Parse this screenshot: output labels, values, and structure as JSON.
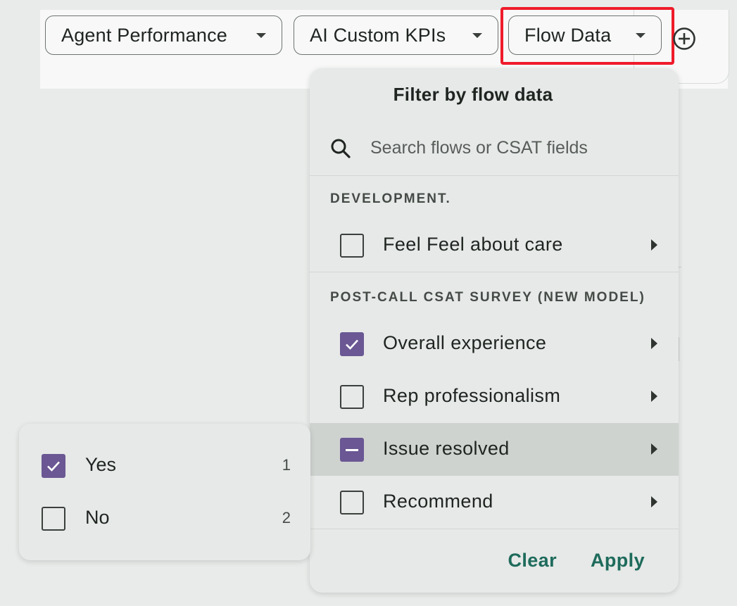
{
  "toolbar": {
    "chips": [
      {
        "label": "Agent Performance"
      },
      {
        "label": "AI Custom KPIs"
      },
      {
        "label": "Flow Data"
      }
    ]
  },
  "flow_panel": {
    "title": "Filter by flow data",
    "search": {
      "placeholder": "Search flows or CSAT fields",
      "value": ""
    },
    "sections": [
      {
        "label": "DEVELOPMENT.",
        "items": [
          {
            "label": "Feel Feel about care",
            "state": "unchecked"
          }
        ]
      },
      {
        "label": "POST-CALL CSAT SURVEY (NEW MODEL)",
        "items": [
          {
            "label": "Overall experience",
            "state": "checked"
          },
          {
            "label": "Rep professionalism",
            "state": "unchecked"
          },
          {
            "label": "Issue resolved",
            "state": "indeterminate"
          },
          {
            "label": "Recommend",
            "state": "unchecked"
          }
        ]
      }
    ],
    "clear_label": "Clear",
    "apply_label": "Apply"
  },
  "sub_panel": {
    "options": [
      {
        "label": "Yes",
        "count": "1",
        "state": "checked"
      },
      {
        "label": "No",
        "count": "2",
        "state": "unchecked"
      }
    ]
  },
  "colors": {
    "accent": "#6a5793",
    "action_text": "#1e6b5c",
    "highlight": "#ef1b2a",
    "hover_row": "#cfd3d0"
  },
  "icons": [
    "chevron-down-icon",
    "add-circle-icon",
    "search-icon",
    "chevron-right-icon",
    "checkmark-icon"
  ]
}
